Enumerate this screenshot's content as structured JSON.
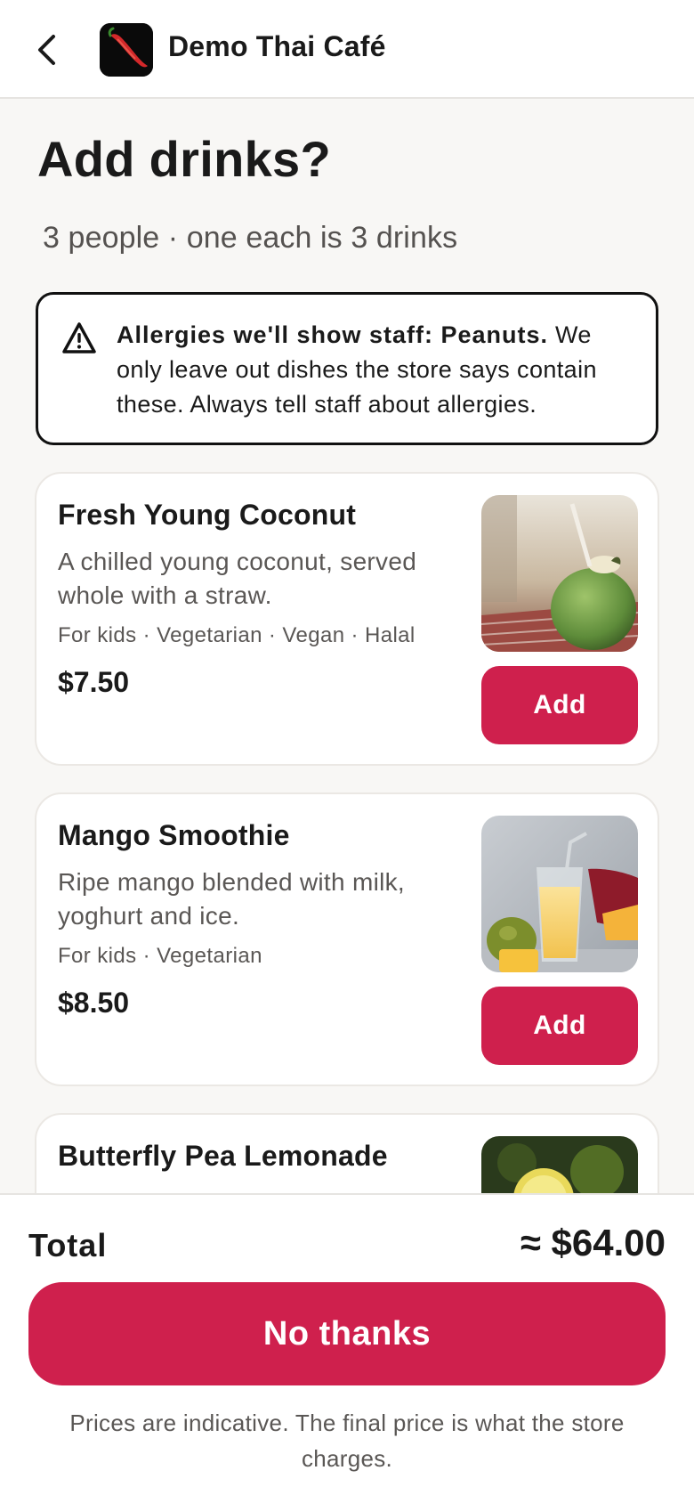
{
  "header": {
    "store_name": "Demo Thai Café",
    "back_icon": "chevron-left-icon",
    "logo_icon": "chili-pepper-logo"
  },
  "main": {
    "title": "Add drinks?",
    "subtitle": "3 people · one each is 3 drinks"
  },
  "allergy": {
    "icon": "warning-icon",
    "bold_text": "Allergies we'll show staff: Peanuts.",
    "body_text": " We only leave out dishes the store says contain these. Always tell staff about allergies."
  },
  "drinks": [
    {
      "name": "Fresh Young Coconut",
      "description": "A chilled young coconut, served whole with a straw.",
      "tags": "For kids · Vegetarian · Vegan · Halal",
      "price": "$7.50",
      "add_label": "Add"
    },
    {
      "name": "Mango Smoothie",
      "description": "Ripe mango blended with milk, yoghurt and ice.",
      "tags": "For kids · Vegetarian",
      "price": "$8.50",
      "add_label": "Add"
    },
    {
      "name": "Butterfly Pea Lemonade"
    }
  ],
  "footer": {
    "total_label": "Total",
    "total_value": "≈ $64.00",
    "no_thanks_label": "No thanks",
    "disclaimer": "Prices are indicative. The final price is what the store charges."
  },
  "colors": {
    "accent": "#cf204d",
    "background": "#f8f7f5",
    "text": "#1a1a1a",
    "muted": "#5a5755"
  }
}
